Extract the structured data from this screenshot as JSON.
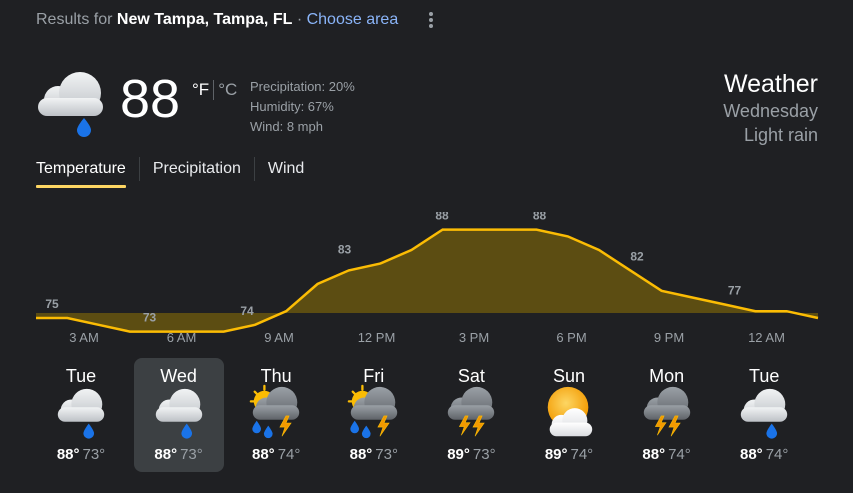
{
  "header": {
    "results_prefix": "Results for",
    "location": "New Tampa, Tampa, FL",
    "separator": "·",
    "choose_area": "Choose area"
  },
  "current": {
    "icon": "rain-cloud-icon",
    "temperature": "88",
    "unit_f": "°F",
    "unit_c": "°C",
    "precipitation": "Precipitation: 20%",
    "humidity": "Humidity: 67%",
    "wind": "Wind: 8 mph"
  },
  "summary": {
    "title": "Weather",
    "day": "Wednesday",
    "condition": "Light rain"
  },
  "tabs": [
    {
      "label": "Temperature",
      "active": true
    },
    {
      "label": "Precipitation",
      "active": false
    },
    {
      "label": "Wind",
      "active": false
    }
  ],
  "chart_data": {
    "type": "area",
    "x": [
      "3 AM",
      "6 AM",
      "9 AM",
      "12 PM",
      "3 PM",
      "6 PM",
      "9 PM",
      "12 AM"
    ],
    "values": [
      75,
      73,
      74,
      83,
      88,
      88,
      82,
      77
    ],
    "series_points": [
      75,
      75,
      74,
      73,
      73,
      73,
      73,
      74,
      76,
      80,
      82,
      83,
      85,
      88,
      88,
      88,
      88,
      87,
      85,
      82,
      79,
      78,
      77,
      76,
      76,
      75
    ],
    "ylim": [
      70,
      90
    ],
    "colors": {
      "line": "#fbbc04",
      "fill": "#5c4d12"
    }
  },
  "forecast": [
    {
      "day": "Tue",
      "icon": "rain-cloud-icon",
      "high": "88°",
      "low": "73°",
      "selected": false
    },
    {
      "day": "Wed",
      "icon": "rain-cloud-icon",
      "high": "88°",
      "low": "73°",
      "selected": true
    },
    {
      "day": "Thu",
      "icon": "scattered-thunderstorms-icon",
      "high": "88°",
      "low": "74°",
      "selected": false
    },
    {
      "day": "Fri",
      "icon": "scattered-thunderstorms-icon",
      "high": "88°",
      "low": "73°",
      "selected": false
    },
    {
      "day": "Sat",
      "icon": "thunderstorm-icon",
      "high": "89°",
      "low": "73°",
      "selected": false
    },
    {
      "day": "Sun",
      "icon": "mostly-sunny-icon",
      "high": "89°",
      "low": "74°",
      "selected": false
    },
    {
      "day": "Mon",
      "icon": "thunderstorm-icon",
      "high": "88°",
      "low": "74°",
      "selected": false
    },
    {
      "day": "Tue",
      "icon": "rain-cloud-icon",
      "high": "88°",
      "low": "74°",
      "selected": false
    }
  ]
}
